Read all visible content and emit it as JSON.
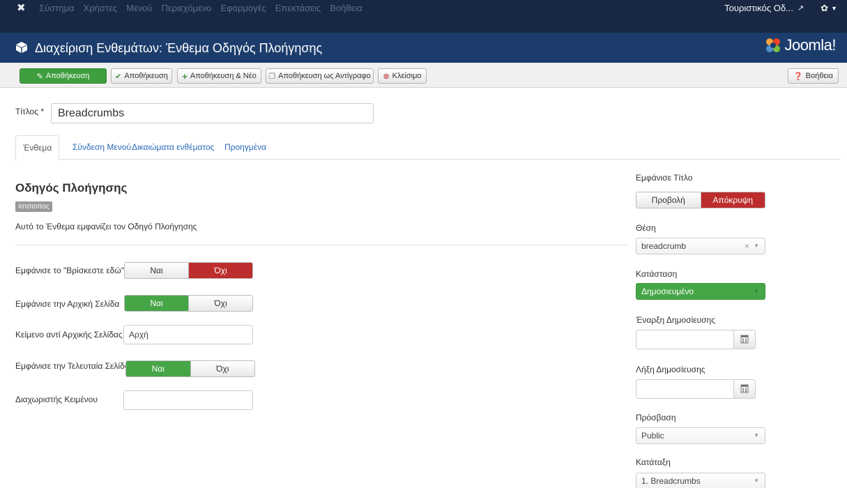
{
  "topnav": {
    "logo_icon": "joomla-x-icon",
    "menu": [
      "Σύστημα",
      "Χρήστες",
      "Μενού",
      "Περιεχόμενο",
      "Εφαρμογές",
      "Επεκτάσεις",
      "Βοήθεια"
    ],
    "site_link": "Τουριστικός Οδ...",
    "site_link_icon": "external-link-icon",
    "user_icon": "gear-icon"
  },
  "header": {
    "title": "Διαχείριση Ενθεμάτων: Ένθεμα Οδηγός Πλοήγησης",
    "brand": "Joomla!"
  },
  "toolbar": {
    "save": "Αποθήκευση",
    "save_close": "Αποθήκευση",
    "save_new": "Αποθήκευση & Νέο",
    "save_copy": "Αποθήκευση ως Αντίγραφο",
    "close": "Κλείσιμο",
    "help": "Βοήθεια"
  },
  "form": {
    "title_label": "Τίτλος *",
    "title_value": "Breadcrumbs"
  },
  "tabs": [
    "Ένθεμα",
    "Σύνδεση Μενού",
    "Δικαιώματα ενθέματος",
    "Προηγμένα"
  ],
  "module": {
    "name": "Οδηγός Πλοήγησης",
    "badge": "Ιστότοπος",
    "description": "Αυτό το Ένθεμα εμφανίζει τον Οδηγό Πλοήγησης"
  },
  "options": {
    "here_label": "Εμφάνισε το \"Βρίσκεστε εδώ\"",
    "home_label": "Εμφάνισε την Αρχική Σελίδα",
    "home_text_label": "Κείμενο αντί Αρχικής Σελίδας",
    "home_text_value": "Αρχή",
    "last_label": "Εμφάνισε την Τελευταία Σελίδα",
    "separator_label": "Διαχωριστής Κειμένου",
    "yes": "Ναι",
    "no": "Όχι"
  },
  "sidebar": {
    "show_title_label": "Εμφάνισε Τίτλο",
    "show": "Προβολή",
    "hide": "Απόκρυψη",
    "position_label": "Θέση",
    "position_value": "breadcrumb",
    "status_label": "Κατάσταση",
    "status_value": "Δημοσιευμένο",
    "publish_up_label": "Έναρξη Δημοσίευσης",
    "publish_down_label": "Λήξη Δημοσίευσης",
    "access_label": "Πρόσβαση",
    "access_value": "Public",
    "ordering_label": "Κατάταξη",
    "ordering_value": "1. Breadcrumbs"
  }
}
